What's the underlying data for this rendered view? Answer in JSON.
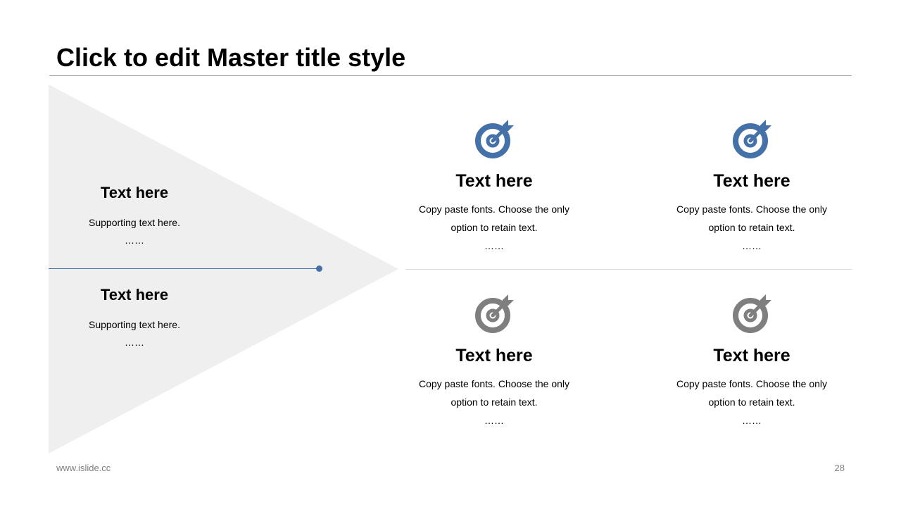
{
  "slide": {
    "title": "Click to edit Master title style",
    "footer_url": "www.islide.cc",
    "page_number": "28"
  },
  "colors": {
    "accent": "#4472A8",
    "grey_icon": "#7F7F7F",
    "triangle_fill": "#EFEFEF",
    "divider": "#D9D9D9",
    "title_rule": "#A6A6A6"
  },
  "left_panel": {
    "items": [
      {
        "heading": "Text here",
        "subtext": "Supporting text here.",
        "ellipsis": "……"
      },
      {
        "heading": "Text here",
        "subtext": "Supporting text here.",
        "ellipsis": "……"
      }
    ]
  },
  "cards": [
    {
      "icon": "target-icon",
      "icon_color": "blue",
      "heading": "Text here",
      "line1": "Copy paste fonts. Choose the only",
      "line2": "option to retain text.",
      "ellipsis": "……"
    },
    {
      "icon": "target-icon",
      "icon_color": "blue",
      "heading": "Text here",
      "line1": "Copy paste fonts. Choose the only",
      "line2": "option to retain text.",
      "ellipsis": "……"
    },
    {
      "icon": "target-icon",
      "icon_color": "grey",
      "heading": "Text here",
      "line1": "Copy paste fonts. Choose the only",
      "line2": "option to retain text.",
      "ellipsis": "……"
    },
    {
      "icon": "target-icon",
      "icon_color": "grey",
      "heading": "Text here",
      "line1": "Copy paste fonts. Choose the only",
      "line2": "option to retain text.",
      "ellipsis": "……"
    }
  ]
}
